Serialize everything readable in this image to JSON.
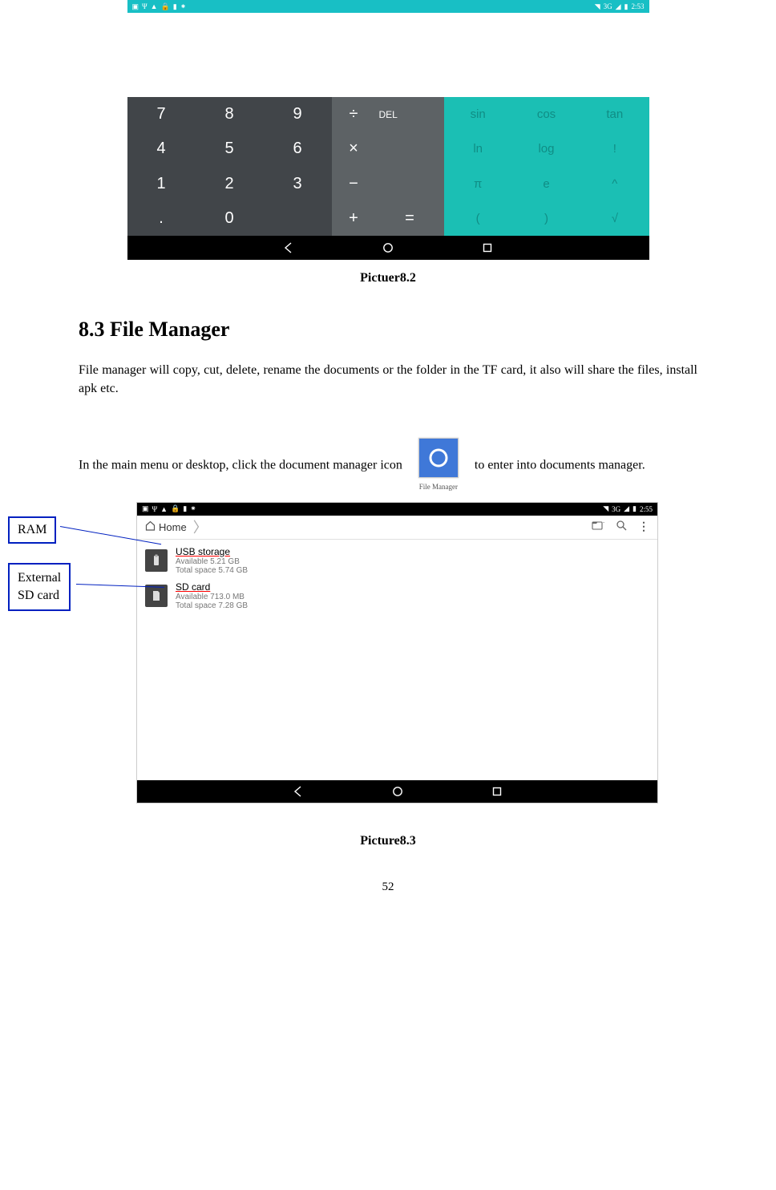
{
  "calc": {
    "statusbar": {
      "network": "3G",
      "signal": "▲",
      "battery": "▮",
      "time": "2:53"
    },
    "numpad": [
      "7",
      "8",
      "9",
      "4",
      "5",
      "6",
      "1",
      "2",
      "3",
      ".",
      "0",
      ""
    ],
    "ops": [
      "÷",
      "×",
      "−",
      "+"
    ],
    "del": "DEL",
    "eq": "=",
    "sci": [
      "sin",
      "cos",
      "tan",
      "ln",
      "log",
      "!",
      "π",
      "e",
      "^",
      "(",
      ")",
      "√"
    ]
  },
  "caption1": "Pictuer8.2",
  "section_heading": "8.3 File Manager",
  "para1": "File manager will copy, cut, delete, rename the documents or the folder in the TF card, it also will share the files, install apk etc.",
  "para2_pre": "In the main menu or desktop, click the document manager icon",
  "para2_post": "to enter into documents manager.",
  "icon_label": "File Manager",
  "callout1": "RAM",
  "callout2_l1": "External",
  "callout2_l2": "SD card",
  "fm": {
    "status_time": "2:55",
    "status_net": "3G",
    "breadcrumb": "Home",
    "usb": {
      "title": "USB storage",
      "avail": "Available 5.21 GB",
      "total": "Total space 5.74 GB"
    },
    "sd": {
      "title": "SD card",
      "avail": "Available 713.0 MB",
      "total": "Total space 7.28 GB"
    }
  },
  "caption2": "Picture8.3",
  "page_number": "52"
}
